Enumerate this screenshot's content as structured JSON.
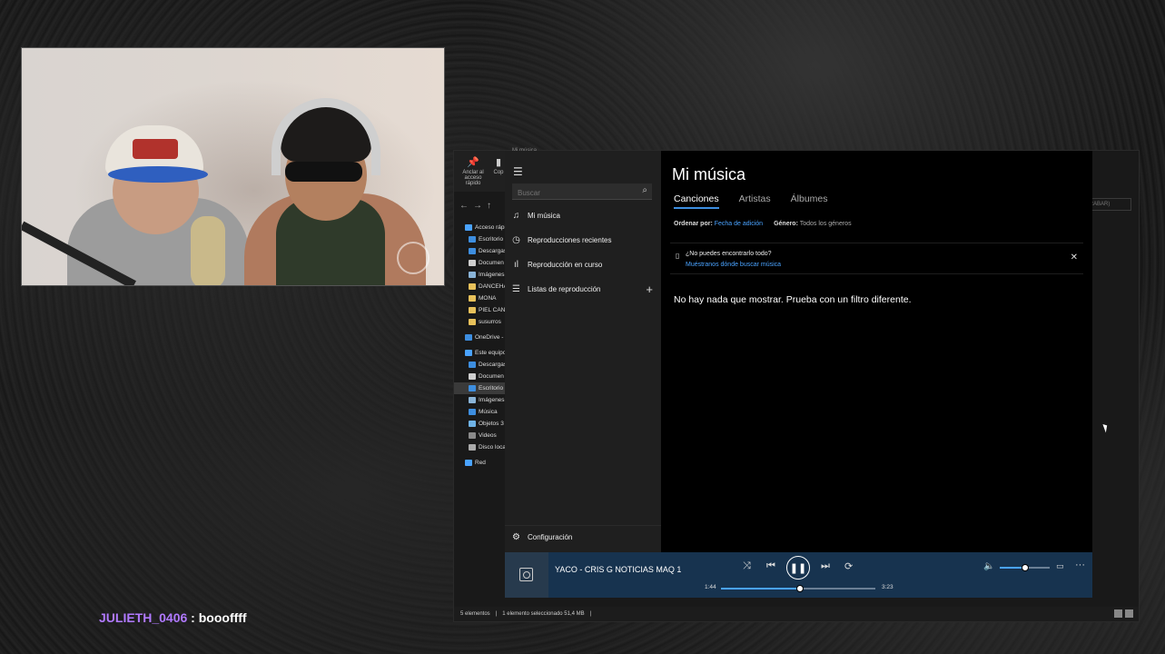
{
  "chat": {
    "username": "JULIETH_0406",
    "separator": " : ",
    "message": "boooffff"
  },
  "explorer": {
    "ribbon": {
      "pin_label": "Anclar al acceso rápido",
      "copy_label": "Cop"
    },
    "title_fragment": "Mi música",
    "right_field_text": "GRABAR)",
    "tree": [
      {
        "label": "Acceso rápi",
        "color": "#4aa3ff"
      },
      {
        "label": "Escritorio",
        "color": "#3d8ee0"
      },
      {
        "label": "Descargas",
        "color": "#3d8ee0"
      },
      {
        "label": "Documen",
        "color": "#cfcfcf"
      },
      {
        "label": "Imágenes",
        "color": "#8ab4d8"
      },
      {
        "label": "DANCEHA",
        "color": "#e8c15a"
      },
      {
        "label": "MONA",
        "color": "#e8c15a"
      },
      {
        "label": "PIEL CAN",
        "color": "#e8c15a"
      },
      {
        "label": "susurros",
        "color": "#e8c15a"
      },
      {
        "label": "OneDrive -",
        "color": "#3d8ee0"
      },
      {
        "label": "Este equipo",
        "color": "#4aa3ff"
      },
      {
        "label": "Descargas",
        "color": "#3d8ee0"
      },
      {
        "label": "Documen",
        "color": "#cfcfcf"
      },
      {
        "label": "Escritorio",
        "color": "#3d8ee0"
      },
      {
        "label": "Imágenes",
        "color": "#8ab4d8"
      },
      {
        "label": "Música",
        "color": "#3d8ee0"
      },
      {
        "label": "Objetos 3",
        "color": "#6fb3e6"
      },
      {
        "label": "Videos",
        "color": "#8a8a8a"
      },
      {
        "label": "Disco loca",
        "color": "#aaaaaa"
      },
      {
        "label": "Red",
        "color": "#4aa3ff"
      }
    ],
    "status": {
      "count": "5 elementos",
      "selection": "1 elemento seleccionado 51,4 MB"
    }
  },
  "groove": {
    "search_placeholder": "Buscar",
    "nav": {
      "my_music": "Mi música",
      "recent": "Reproducciones recientes",
      "now_playing": "Reproducción en curso",
      "playlists": "Listas de reproducción",
      "settings": "Configuración"
    },
    "title": "Mi música",
    "tabs": [
      "Canciones",
      "Artistas",
      "Álbumes"
    ],
    "filters": {
      "sort_label": "Ordenar por:",
      "sort_value": "Fecha de adición",
      "genre_label": "Género:",
      "genre_value": "Todos los géneros"
    },
    "notice": {
      "title": "¿No puedes encontrarlo todo?",
      "link": "Muéstranos dónde buscar música"
    },
    "empty_message": "No hay nada que mostrar. Prueba con un filtro diferente.",
    "player": {
      "song": "YACO - CRIS G NOTICIAS MAQ 1",
      "elapsed": "1:44",
      "duration": "3:23",
      "progress": 0.51,
      "volume": 0.5
    }
  },
  "icons": {
    "hamburger": "hamburger-icon",
    "search": "search-icon",
    "music_note": "music-note-icon",
    "history": "history-icon",
    "equalizer": "equalizer-icon",
    "list": "playlist-icon",
    "plus": "plus-icon",
    "gear": "gear-icon",
    "shuffle": "shuffle-icon",
    "previous": "previous-icon",
    "pause": "pause-icon",
    "next": "next-icon",
    "repeat": "repeat-icon",
    "volume": "volume-icon",
    "mini_view": "mini-view-icon",
    "more": "more-icon"
  },
  "colors": {
    "accent": "#4aa3ff",
    "player_bar": "#17334f",
    "chat_user": "#b079ff"
  }
}
